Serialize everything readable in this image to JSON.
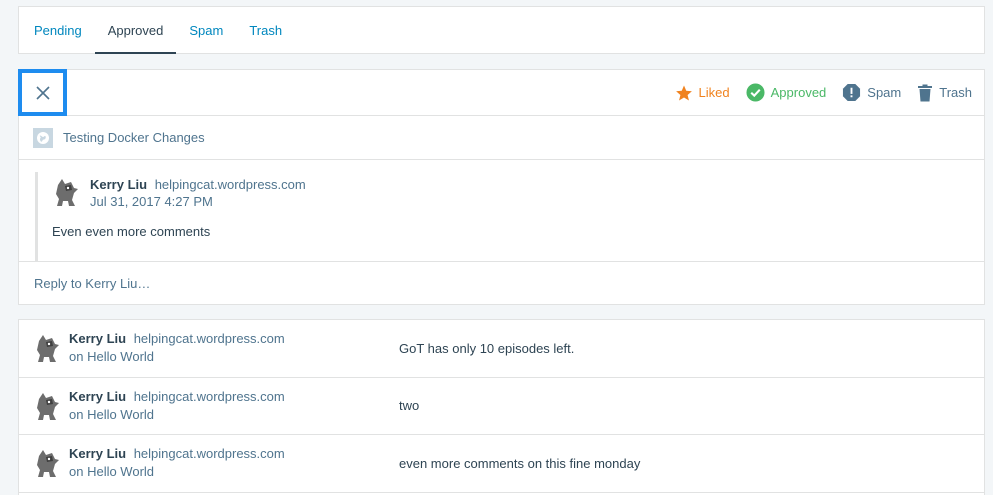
{
  "tabs": [
    {
      "label": "Pending",
      "active": false
    },
    {
      "label": "Approved",
      "active": true
    },
    {
      "label": "Spam",
      "active": false
    },
    {
      "label": "Trash",
      "active": false
    }
  ],
  "actions": {
    "liked": "Liked",
    "approved": "Approved",
    "spam": "Spam",
    "trash": "Trash"
  },
  "detail": {
    "post_title": "Testing Docker Changes",
    "author": "Kerry Liu",
    "author_site": "helpingcat.wordpress.com",
    "date": "Jul 31, 2017 4:27 PM",
    "text": "Even even more comments",
    "reply_placeholder": "Reply to Kerry Liu…"
  },
  "list": [
    {
      "author": "Kerry Liu",
      "site": "helpingcat.wordpress.com",
      "post": "on Hello World",
      "excerpt": "GoT has only 10 episodes left."
    },
    {
      "author": "Kerry Liu",
      "site": "helpingcat.wordpress.com",
      "post": "on Hello World",
      "excerpt": "two"
    },
    {
      "author": "Kerry Liu",
      "site": "helpingcat.wordpress.com",
      "post": "on Hello World",
      "excerpt": "even more comments on this fine monday"
    }
  ],
  "colors": {
    "link": "#0087be",
    "liked": "#f0821e",
    "approved": "#4ab866",
    "muted": "#4f748e",
    "focus": "#1e8cef"
  }
}
